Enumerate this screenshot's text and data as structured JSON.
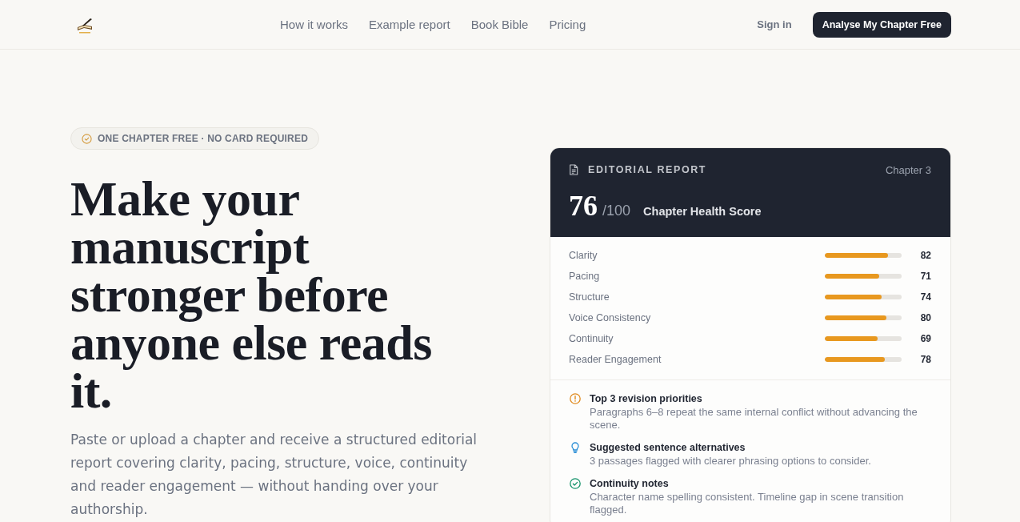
{
  "nav": {
    "links": [
      "How it works",
      "Example report",
      "Book Bible",
      "Pricing"
    ],
    "sign_in": "Sign in",
    "cta": "Analyse My Chapter Free"
  },
  "hero": {
    "badge": "ONE CHAPTER FREE · NO CARD REQUIRED",
    "headline": "Make your manuscript stronger before anyone else reads it.",
    "lead": "Paste or upload a chapter and receive a structured editorial report covering clarity, pacing, structure, voice, continuity and reader engagement — without handing over your authorship."
  },
  "report": {
    "title": "EDITORIAL REPORT",
    "chapter": "Chapter 3",
    "score": "76",
    "score_max": "/100",
    "score_label": "Chapter Health Score",
    "metrics": [
      {
        "name": "Clarity",
        "level": 0.82,
        "score": "82"
      },
      {
        "name": "Pacing",
        "level": 0.71,
        "score": "71"
      },
      {
        "name": "Structure",
        "level": 0.74,
        "score": "74"
      },
      {
        "name": "Voice Consistency",
        "level": 0.8,
        "score": "80"
      },
      {
        "name": "Continuity",
        "level": 0.69,
        "score": "69"
      },
      {
        "name": "Reader Engagement",
        "level": 0.78,
        "score": "78"
      }
    ],
    "notes": [
      {
        "kind": "warning",
        "title": "Top 3 revision priorities",
        "text": "Paragraphs 6–8 repeat the same internal conflict without advancing the scene."
      },
      {
        "kind": "tip",
        "title": "Suggested sentence alternatives",
        "text": "3 passages flagged with clearer phrasing options to consider."
      },
      {
        "kind": "check",
        "title": "Continuity notes",
        "text": "Character name spelling consistent. Timeline gap in scene transition flagged."
      }
    ]
  }
}
